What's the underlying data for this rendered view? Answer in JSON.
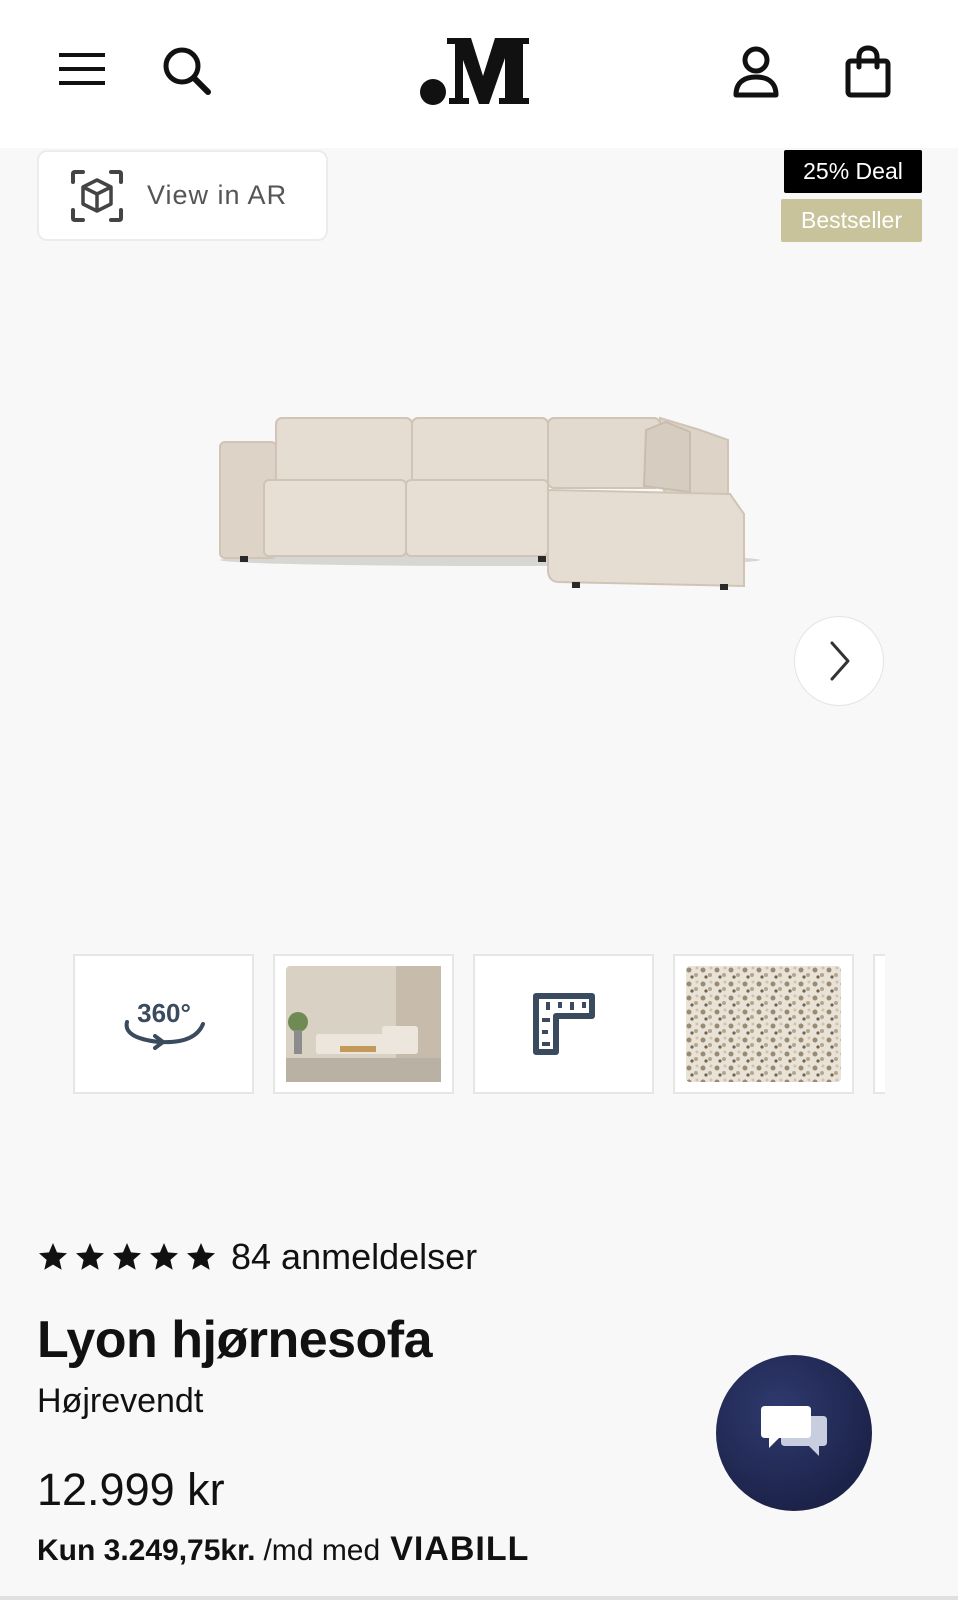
{
  "header": {
    "menu_icon": "hamburger-menu-icon",
    "search_icon": "search-icon",
    "logo_text": ".M",
    "account_icon": "user-icon",
    "cart_icon": "shopping-bag-icon"
  },
  "gallery": {
    "ar_label": "View in AR",
    "ar_icon": "ar-cube-icon",
    "badges": [
      "25% Deal",
      "Bestseller"
    ],
    "next_icon": "chevron-right-icon",
    "thumbnails": [
      "360°",
      "room-photo",
      "dimensions-icon",
      "fabric-swatch"
    ],
    "thumb_360_label": "360°"
  },
  "product": {
    "rating_stars": 5,
    "reviews": "84 anmeldelser",
    "title": "Lyon hjørnesofa",
    "variant": "Højrevendt",
    "price": "12.999 kr",
    "financing_amount": "Kun 3.249,75kr.",
    "financing_text": "/md med",
    "financing_brand": "VIABILL"
  },
  "chat": {
    "icon": "chat-bubbles-icon"
  },
  "colors": {
    "deal_badge_bg": "#000000",
    "bestseller_badge_bg": "#c8c39a",
    "chat_bg": "#1f2550",
    "page_bg": "#f8f8f8"
  }
}
